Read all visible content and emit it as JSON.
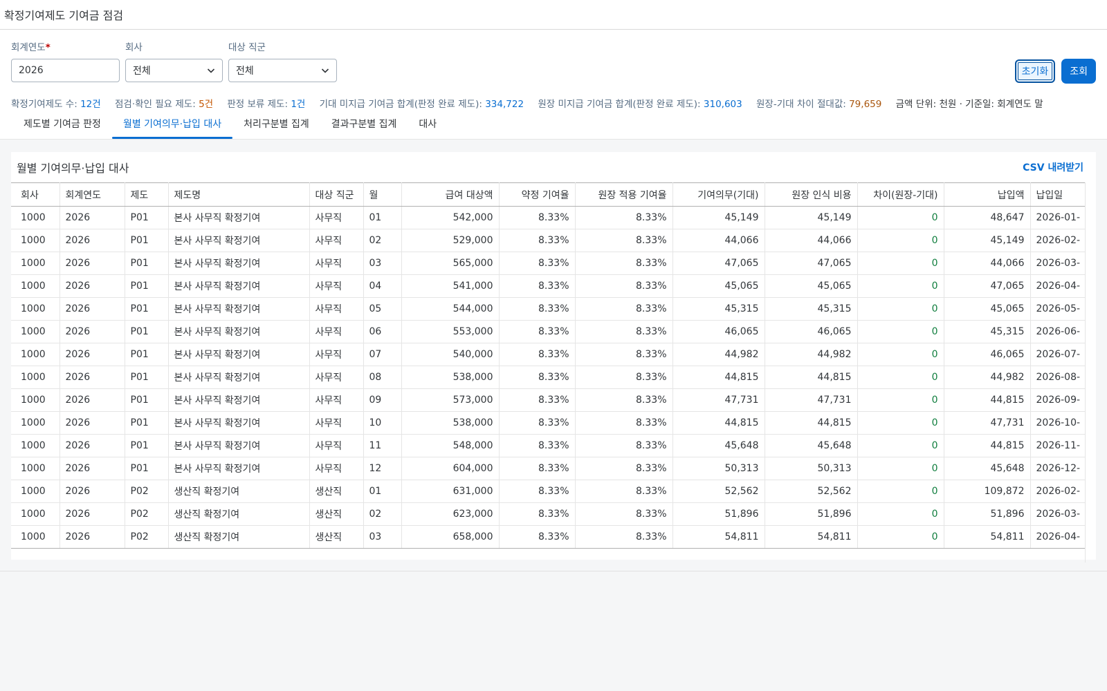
{
  "header": {
    "title": "확정기여제도 기여금 점검"
  },
  "filters": {
    "fiscal_year": {
      "label": "회계연도",
      "required_mark": "*",
      "value": "2026"
    },
    "company": {
      "label": "회사",
      "value": "전체"
    },
    "job_group": {
      "label": "대상 직군",
      "value": "전체"
    },
    "reset_label": "초기화",
    "search_label": "조회"
  },
  "summary": {
    "plans_label": "확정기여제도 수: ",
    "plans_value": "12건",
    "check_label": "점검·확인 필요 제도: ",
    "check_value": "5건",
    "hold_label": "판정 보류 제도: ",
    "hold_value": "1건",
    "expected_label": "기대 미지급 기여금 합계(판정 완료 제도): ",
    "expected_value": "334,722",
    "ledger_label": "원장 미지급 기여금 합계(판정 완료 제도): ",
    "ledger_value": "310,603",
    "diff_label": "원장-기대 차이 절대값: ",
    "diff_value": "79,659",
    "unit_text": "금액 단위: 천원 · 기준일: 회계연도 말"
  },
  "tabs": [
    {
      "label": "제도별 기여금 판정",
      "active": false
    },
    {
      "label": "월별 기여의무·납입 대사",
      "active": true
    },
    {
      "label": "처리구분별 집계",
      "active": false
    },
    {
      "label": "결과구분별 집계",
      "active": false
    },
    {
      "label": "대사",
      "active": false
    }
  ],
  "panel": {
    "title": "월별 기여의무·납입 대사",
    "csv_label": "CSV 내려받기"
  },
  "table": {
    "columns": [
      "회사",
      "회계연도",
      "제도",
      "제도명",
      "대상 직군",
      "월",
      "급여 대상액",
      "약정 기여율",
      "원장 적용 기여율",
      "기여의무(기대)",
      "원장 인식 비용",
      "차이(원장-기대)",
      "납입액",
      "납입일"
    ],
    "rows": [
      [
        "1000",
        "2026",
        "P01",
        "본사 사무직 확정기여",
        "사무직",
        "01",
        "542,000",
        "8.33%",
        "8.33%",
        "45,149",
        "45,149",
        "0",
        "48,647",
        "2026-01-"
      ],
      [
        "1000",
        "2026",
        "P01",
        "본사 사무직 확정기여",
        "사무직",
        "02",
        "529,000",
        "8.33%",
        "8.33%",
        "44,066",
        "44,066",
        "0",
        "45,149",
        "2026-02-"
      ],
      [
        "1000",
        "2026",
        "P01",
        "본사 사무직 확정기여",
        "사무직",
        "03",
        "565,000",
        "8.33%",
        "8.33%",
        "47,065",
        "47,065",
        "0",
        "44,066",
        "2026-03-"
      ],
      [
        "1000",
        "2026",
        "P01",
        "본사 사무직 확정기여",
        "사무직",
        "04",
        "541,000",
        "8.33%",
        "8.33%",
        "45,065",
        "45,065",
        "0",
        "47,065",
        "2026-04-"
      ],
      [
        "1000",
        "2026",
        "P01",
        "본사 사무직 확정기여",
        "사무직",
        "05",
        "544,000",
        "8.33%",
        "8.33%",
        "45,315",
        "45,315",
        "0",
        "45,065",
        "2026-05-"
      ],
      [
        "1000",
        "2026",
        "P01",
        "본사 사무직 확정기여",
        "사무직",
        "06",
        "553,000",
        "8.33%",
        "8.33%",
        "46,065",
        "46,065",
        "0",
        "45,315",
        "2026-06-"
      ],
      [
        "1000",
        "2026",
        "P01",
        "본사 사무직 확정기여",
        "사무직",
        "07",
        "540,000",
        "8.33%",
        "8.33%",
        "44,982",
        "44,982",
        "0",
        "46,065",
        "2026-07-"
      ],
      [
        "1000",
        "2026",
        "P01",
        "본사 사무직 확정기여",
        "사무직",
        "08",
        "538,000",
        "8.33%",
        "8.33%",
        "44,815",
        "44,815",
        "0",
        "44,982",
        "2026-08-"
      ],
      [
        "1000",
        "2026",
        "P01",
        "본사 사무직 확정기여",
        "사무직",
        "09",
        "573,000",
        "8.33%",
        "8.33%",
        "47,731",
        "47,731",
        "0",
        "44,815",
        "2026-09-"
      ],
      [
        "1000",
        "2026",
        "P01",
        "본사 사무직 확정기여",
        "사무직",
        "10",
        "538,000",
        "8.33%",
        "8.33%",
        "44,815",
        "44,815",
        "0",
        "47,731",
        "2026-10-"
      ],
      [
        "1000",
        "2026",
        "P01",
        "본사 사무직 확정기여",
        "사무직",
        "11",
        "548,000",
        "8.33%",
        "8.33%",
        "45,648",
        "45,648",
        "0",
        "44,815",
        "2026-11-"
      ],
      [
        "1000",
        "2026",
        "P01",
        "본사 사무직 확정기여",
        "사무직",
        "12",
        "604,000",
        "8.33%",
        "8.33%",
        "50,313",
        "50,313",
        "0",
        "45,648",
        "2026-12-"
      ],
      [
        "1000",
        "2026",
        "P02",
        "생산직 확정기여",
        "생산직",
        "01",
        "631,000",
        "8.33%",
        "8.33%",
        "52,562",
        "52,562",
        "0",
        "109,872",
        "2026-02-"
      ],
      [
        "1000",
        "2026",
        "P02",
        "생산직 확정기여",
        "생산직",
        "02",
        "623,000",
        "8.33%",
        "8.33%",
        "51,896",
        "51,896",
        "0",
        "51,896",
        "2026-03-"
      ],
      [
        "1000",
        "2026",
        "P02",
        "생산직 확정기여",
        "생산직",
        "03",
        "658,000",
        "8.33%",
        "8.33%",
        "54,811",
        "54,811",
        "0",
        "54,811",
        "2026-04-"
      ]
    ]
  }
}
